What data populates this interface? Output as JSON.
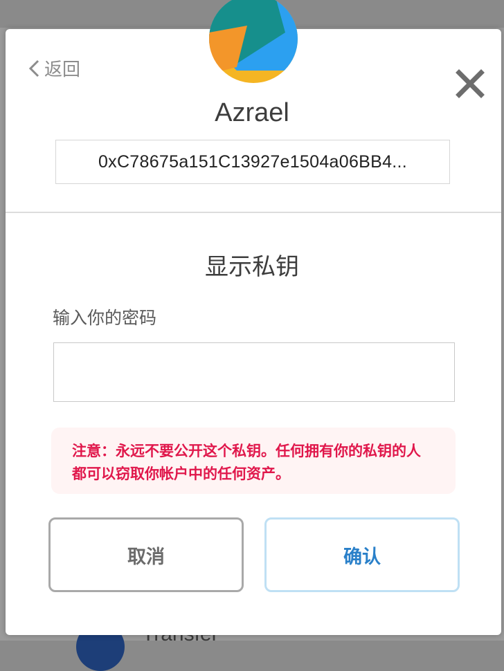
{
  "header": {
    "back_label": "返回",
    "account_name": "Azrael",
    "address": "0xC78675a151C13927e1504a06BB4..."
  },
  "dialog": {
    "title": "显示私钥",
    "password_label": "输入你的密码",
    "password_value": "",
    "warning_text": "注意：永远不要公开这个私钥。任何拥有你的私钥的人都可以窃取你帐户中的任何资产。",
    "cancel_label": "取消",
    "confirm_label": "确认"
  },
  "background": {
    "partial_text": "Transfer"
  },
  "colors": {
    "warning_text": "#e0174b",
    "warning_bg": "#fff4f4",
    "confirm_text": "#2a80c9",
    "confirm_border": "#bfe0f4"
  },
  "icons": {
    "back": "chevron-left-icon",
    "close": "close-icon",
    "avatar": "jazzicon-avatar"
  }
}
